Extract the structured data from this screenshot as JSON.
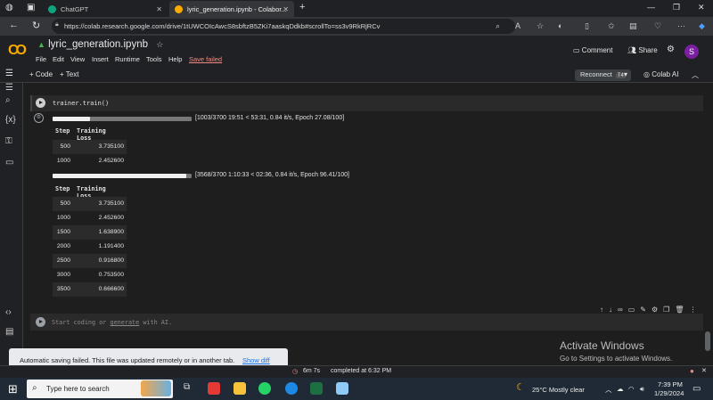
{
  "browser": {
    "tabs": [
      {
        "title": "ChatGPT"
      },
      {
        "title": "lyric_generation.ipynb - Colabor..."
      }
    ],
    "url": "https://colab.research.google.com/drive/1tUWCOIcAwcS8sbftzB5ZKi7aaskqDdkb#scrollTo=ss3v9RkRjRCv"
  },
  "colab": {
    "notebook_title": "lyric_generation.ipynb",
    "menu": [
      "File",
      "Edit",
      "View",
      "Insert",
      "Runtime",
      "Tools",
      "Help"
    ],
    "save_status": "Save failed",
    "comment_label": "Comment",
    "share_label": "Share",
    "avatar_letter": "S",
    "add_code": "+ Code",
    "add_text": "+ Text",
    "reconnect_label": "Reconnect",
    "runtime_badge": "T4",
    "colab_ai_label": "Colab AI"
  },
  "cell1": {
    "code": "trainer.train()",
    "progress1": {
      "fraction": 0.271,
      "text": "[1003/3700 19:51 < 53:31, 0.84 it/s, Epoch 27.08/100]"
    },
    "table1": {
      "headers": [
        "Step",
        "Training Loss"
      ],
      "rows": [
        [
          "500",
          "3.735100"
        ],
        [
          "1000",
          "2.452600"
        ]
      ]
    },
    "progress2": {
      "fraction": 0.964,
      "text": "[3568/3700 1:10:33 < 02:36, 0.84 it/s, Epoch 96.41/100]"
    },
    "table2": {
      "headers": [
        "Step",
        "Training Loss"
      ],
      "rows": [
        [
          "500",
          "3.735100"
        ],
        [
          "1000",
          "2.452600"
        ],
        [
          "1500",
          "1.638900"
        ],
        [
          "2000",
          "1.191400"
        ],
        [
          "2500",
          "0.916800"
        ],
        [
          "3000",
          "0.753500"
        ],
        [
          "3500",
          "0.666600"
        ]
      ]
    }
  },
  "cell2": {
    "placeholder_pre": "Start coding or ",
    "placeholder_link": "generate",
    "placeholder_post": " with AI."
  },
  "activation": {
    "title": "Activate Windows",
    "subtitle": "Go to Settings to activate Windows."
  },
  "toast": {
    "message": "Automatic saving failed. This file was updated remotely or in another tab.",
    "action": "Show diff"
  },
  "statusbar": {
    "elapsed": "6m 7s",
    "completed": "completed at 6:32 PM"
  },
  "taskbar": {
    "search_placeholder": "Type here to search",
    "weather": "25°C  Mostly clear",
    "time": "7:39 PM",
    "date": "1/29/2024"
  },
  "colors": {
    "accent": "#f9ab00",
    "error": "#f28b82",
    "link": "#1a73e8"
  }
}
